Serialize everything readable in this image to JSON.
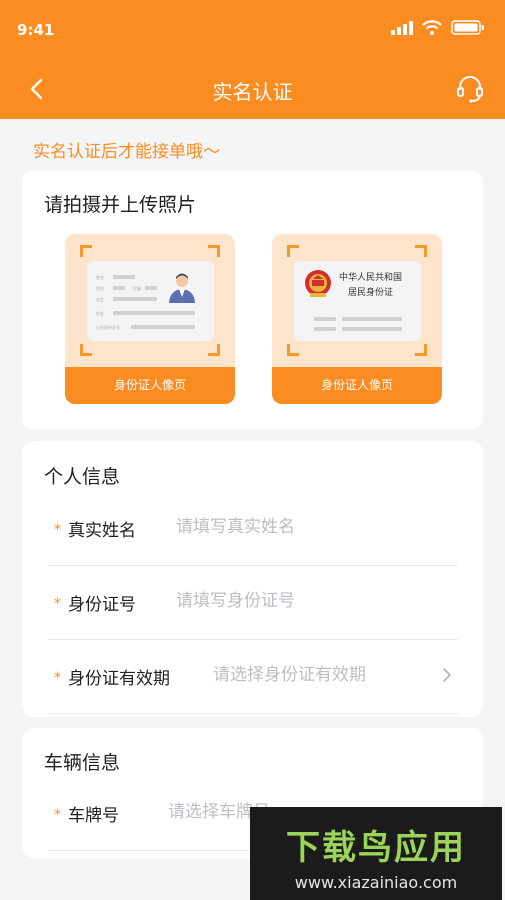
{
  "status_bar": {
    "time": "9:41"
  },
  "nav": {
    "title": "实名认证"
  },
  "notice": "实名认证后才能接单哦～",
  "photo_section": {
    "title": "请拍摄并上传照片",
    "front": {
      "label": "身份证人像页",
      "fields": [
        "姓名",
        "性别",
        "民族",
        "出生",
        "住址",
        "公民身份证号"
      ]
    },
    "back": {
      "label": "身份证人像页",
      "line1": "中华人民共和国",
      "line2": "居民身份证"
    }
  },
  "personal_section": {
    "title": "个人信息",
    "fields": [
      {
        "label": "真实姓名",
        "placeholder": "请填写真实姓名"
      },
      {
        "label": "身份证号",
        "placeholder": "请填写身份证号"
      },
      {
        "label": "身份证有效期",
        "placeholder": "请选择身份证有效期"
      }
    ]
  },
  "vehicle_section": {
    "title": "车辆信息",
    "fields": [
      {
        "label": "车牌号",
        "placeholder": "请选择车牌号"
      }
    ]
  },
  "watermark": {
    "brand": "下载鸟应用",
    "url": "www.xiazainiao.com"
  },
  "colors": {
    "accent": "#fb8c22",
    "background": "#f4f5f7",
    "placeholder": "#bbbec4"
  }
}
